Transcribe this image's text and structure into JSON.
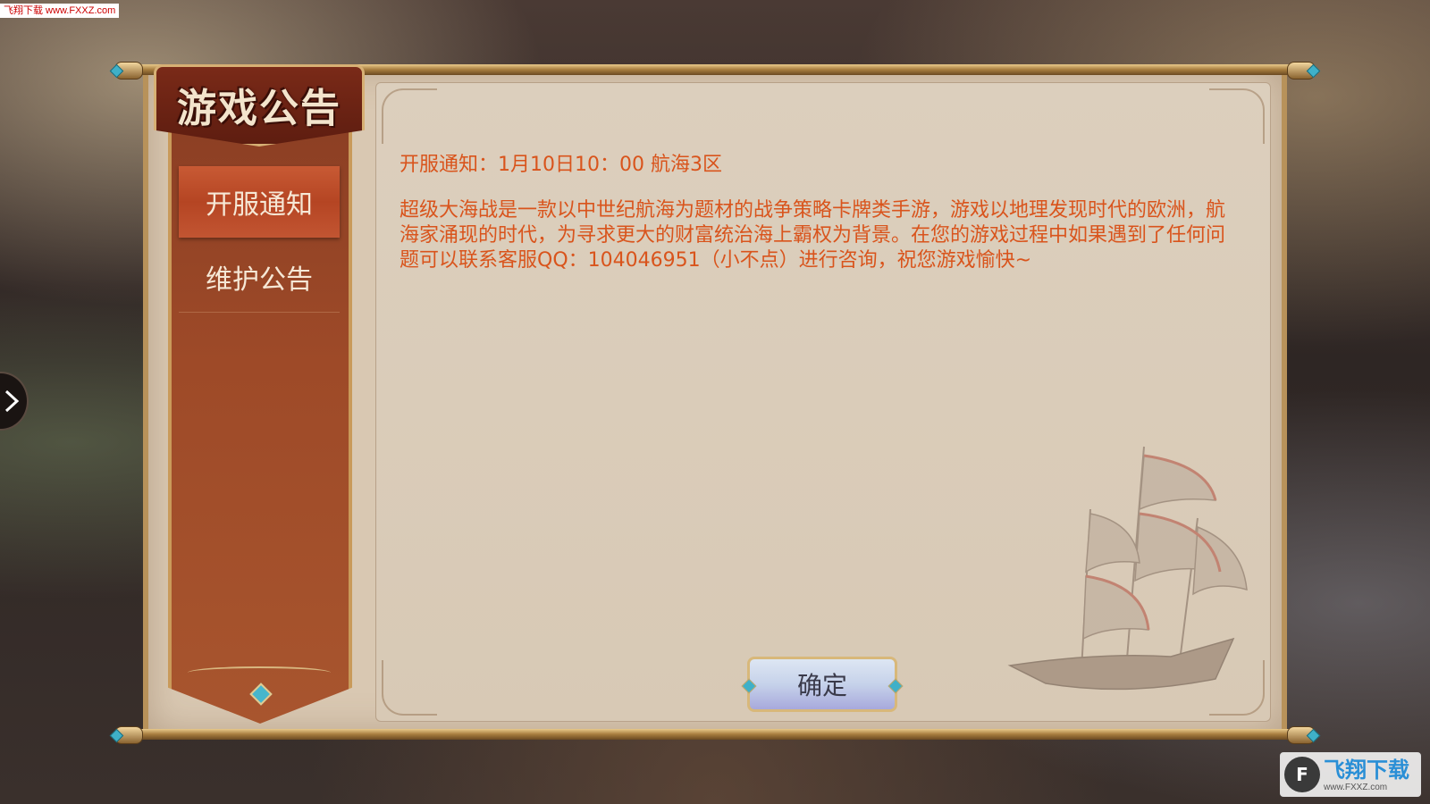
{
  "watermark_top": "飞翔下载 www.FXXZ.com",
  "panel": {
    "title": "游戏公告",
    "tabs": [
      {
        "label": "开服通知",
        "active": true
      },
      {
        "label": "维护公告",
        "active": false
      }
    ]
  },
  "notice": {
    "title": "开服通知：1月10日10：00 航海3区",
    "body": "超级大海战是一款以中世纪航海为题材的战争策略卡牌类手游，游戏以地理发现时代的欧洲，航海家涌现的时代，为寻求更大的财富统治海上霸权为背景。在您的游戏过程中如果遇到了任何问题可以联系客服QQ：104046951（小不点）进行咨询，祝您游戏愉快~"
  },
  "confirm_label": "确定",
  "watermark_br": {
    "name": "飞翔下载",
    "url": "www.FXXZ.com"
  },
  "colors": {
    "notice_text": "#d9541c",
    "sidebar": "#9e4a28",
    "active_tab": "#b54523",
    "panel_bg": "#d9c8b2"
  },
  "icons": [
    "chevron-right-icon",
    "ship-icon",
    "gem-icon"
  ]
}
